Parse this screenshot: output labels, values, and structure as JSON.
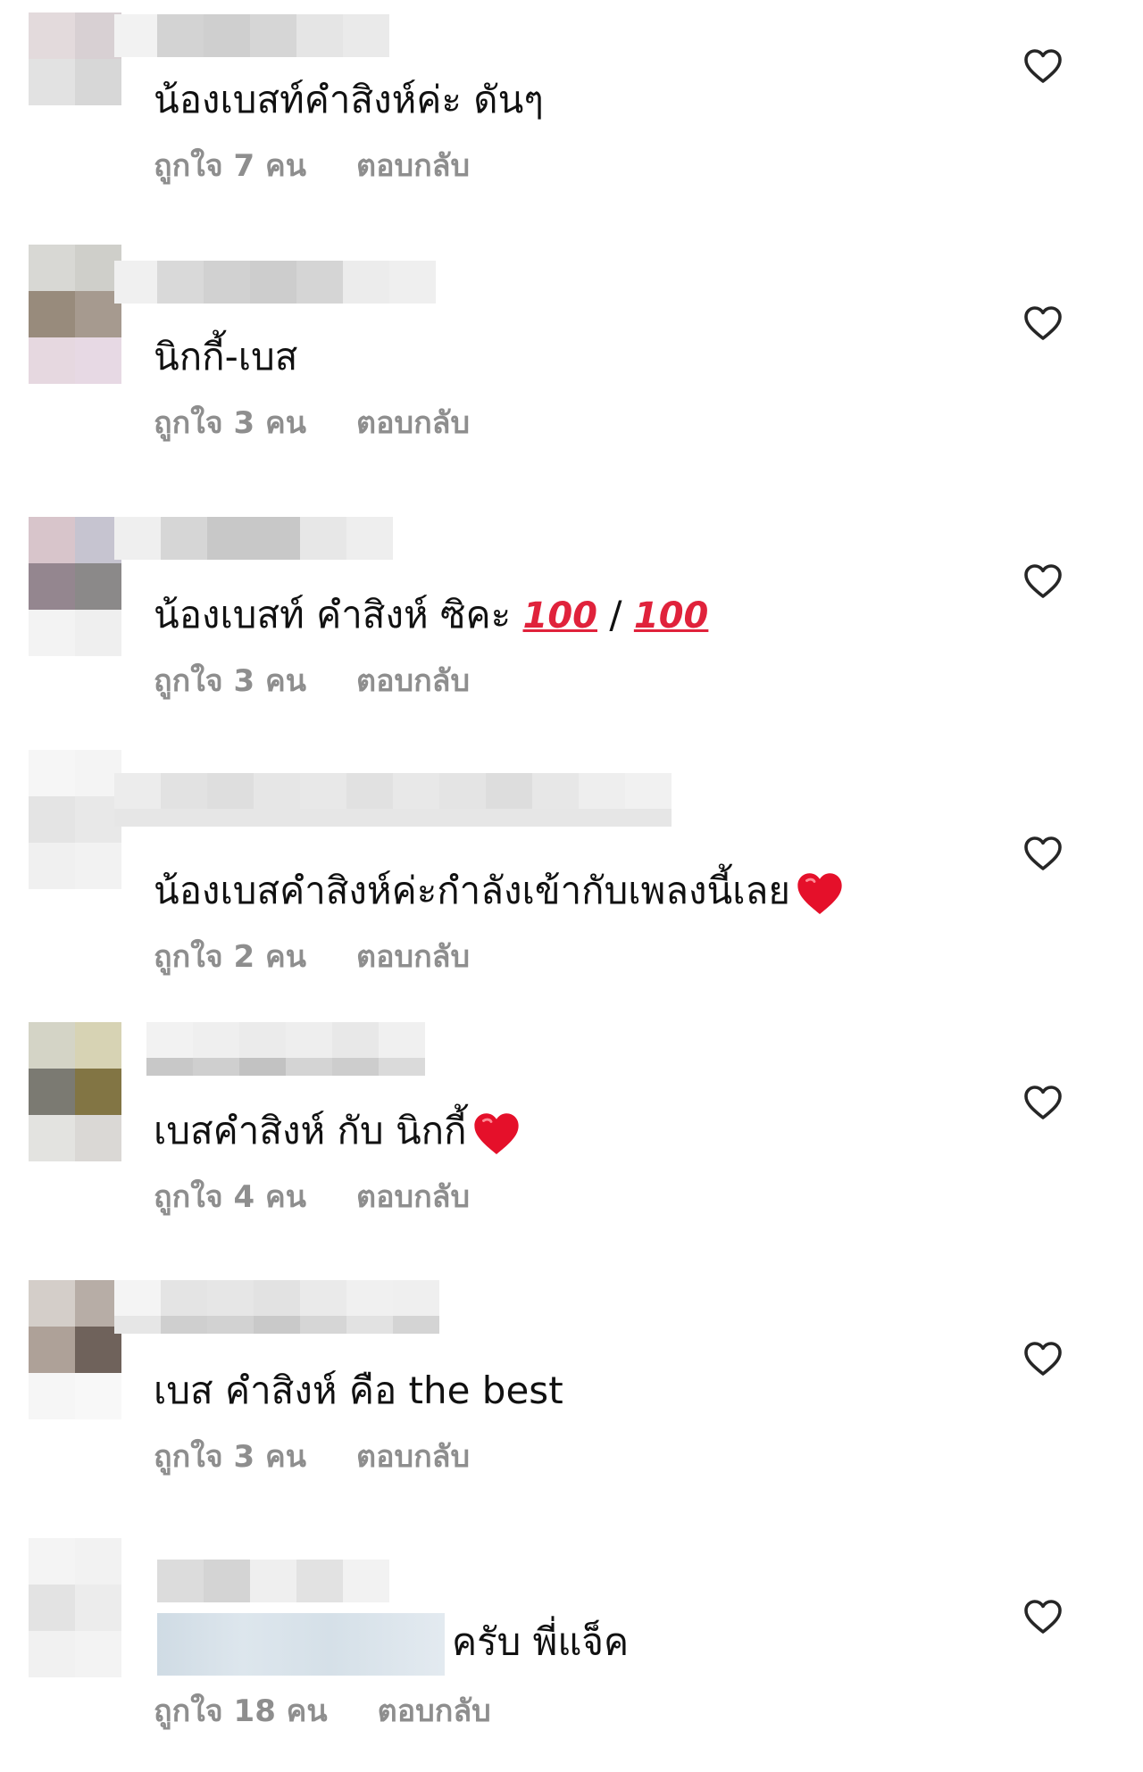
{
  "like_icon": "heart-outline-icon",
  "reply_label": "ตอบกลับ",
  "comments": [
    {
      "text": "น้องเบสท์คำสิงห์ค่ะ ดันๆ",
      "likes": "ถูกใจ 7 คน",
      "avatar_colors": [
        "#e3dadc",
        "#d8d0d3",
        "#e2e2e2",
        "#d7d7d7"
      ]
    },
    {
      "text": "นิกกี้-เบส",
      "likes": "ถูกใจ 3 คน",
      "avatar_colors": [
        "#d8d8d4",
        "#cfcfca",
        "#988b7c",
        "#a69a8f"
      ]
    },
    {
      "text_parts": [
        "น้องเบสท์ คำสิงห์  ซิคะ ",
        "100",
        " / ",
        "100"
      ],
      "likes": "ถูกใจ 3 คน",
      "avatar_colors": [
        "#d8c5cb",
        "#c6c4d0",
        "#94868f",
        "#8b8989"
      ]
    },
    {
      "text": "น้องเบสคำสิงห์ค่ะกำลังเข้ากับเพลงนี้เลย",
      "emoji": "red-heart-emoji",
      "likes": "ถูกใจ 2 คน",
      "avatar_colors": [
        "#f3f3f3",
        "#efefef",
        "#e4e4e4",
        "#e8e8e8"
      ]
    },
    {
      "text": "เบสคำสิงห์  กับ นิกกี้",
      "emoji": "red-heart-emoji",
      "likes": "ถูกใจ 4 คน",
      "avatar_colors": [
        "#d4d4c6",
        "#d7d3b4",
        "#7b7a72",
        "#827544"
      ]
    },
    {
      "text": "เบส คำสิงห์ คือ the best",
      "likes": "ถูกใจ 3 คน",
      "avatar_colors": [
        "#d4cec9",
        "#b7ada6",
        "#aea198",
        "#6f625b"
      ]
    },
    {
      "text": "ครับ พี่แจ็ค",
      "likes": "ถูกใจ 18 คน",
      "avatar_colors": [
        "#f1f1f1",
        "#f3f3f3",
        "#e3e3e3",
        "#ececec"
      ]
    }
  ]
}
